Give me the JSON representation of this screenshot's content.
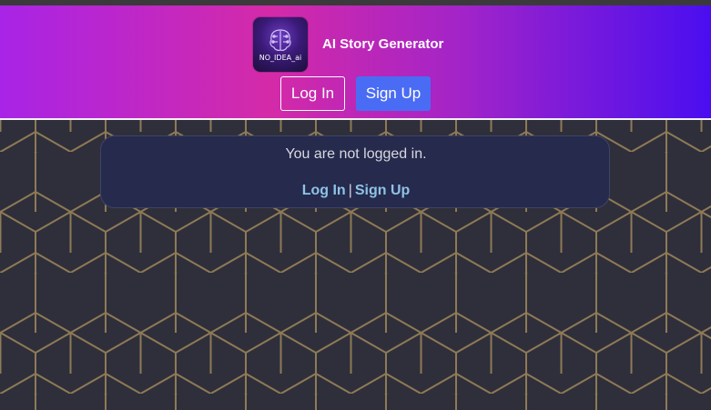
{
  "header": {
    "logo_text": "NO_IDEA_ai",
    "title": "AI Story Generator",
    "login_label": "Log In",
    "signup_label": "Sign Up"
  },
  "notice": {
    "message": "You are not logged in.",
    "login_link": "Log In",
    "separator": "|",
    "signup_link": "Sign Up"
  },
  "colors": {
    "gradient_start": "#a824e6",
    "gradient_mid": "#d42aa8",
    "gradient_end": "#4a0ef0",
    "signup_button": "#4a6cf4",
    "card_background": "#262a4d",
    "link": "#8ec3e6",
    "hex_line": "#8e7a55",
    "page_background": "#2f2f3b"
  }
}
